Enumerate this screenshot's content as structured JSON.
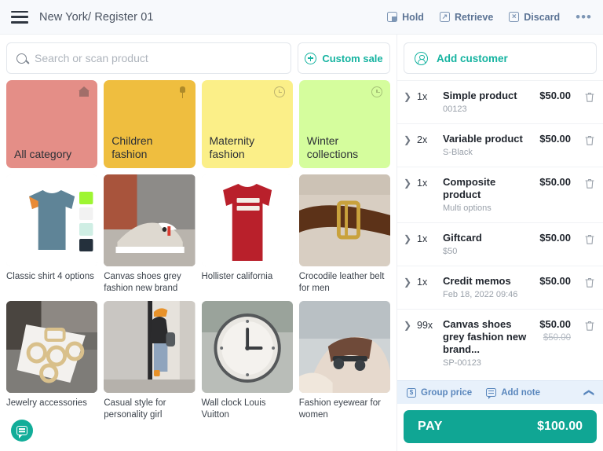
{
  "header": {
    "menu_icon": "hamburger-menu-icon",
    "title": "New York/ Register 01",
    "actions": [
      {
        "label": "Hold",
        "icon": "hold-icon"
      },
      {
        "label": "Retrieve",
        "icon": "retrieve-icon"
      },
      {
        "label": "Discard",
        "icon": "discard-icon"
      }
    ],
    "more_label": "•••"
  },
  "search": {
    "icon": "search-icon",
    "value": "",
    "placeholder": "Search or scan product"
  },
  "custom_sale": {
    "label": "Custom sale",
    "icon": "plus-circle-icon"
  },
  "categories": [
    {
      "label": "All category",
      "icon": "home-icon",
      "color": "#e48e87"
    },
    {
      "label": "Children fashion",
      "icon": "pin-icon",
      "color": "#efbe3f"
    },
    {
      "label": "Maternity fashion",
      "icon": "history-icon",
      "color": "#fbef88"
    },
    {
      "label": "Winter collections",
      "icon": "history-icon",
      "color": "#d5fd9d"
    }
  ],
  "products": [
    {
      "name": "Classic shirt 4 options"
    },
    {
      "name": "Canvas shoes grey fashion new brand"
    },
    {
      "name": "Hollister california"
    },
    {
      "name": "Crocodile leather belt for men"
    },
    {
      "name": "Jewelry accessories"
    },
    {
      "name": "Casual style for personality girl"
    },
    {
      "name": "Wall clock Louis Vuitton"
    },
    {
      "name": "Fashion eyewear for women"
    }
  ],
  "support": {
    "icon": "chat-bubble-icon"
  },
  "add_customer": {
    "label": "Add customer",
    "icon": "user-circle-icon"
  },
  "cart": {
    "items": [
      {
        "qty": "1x",
        "name": "Simple product",
        "sub": "00123",
        "price": "$50.00",
        "old_price": ""
      },
      {
        "qty": "2x",
        "name": "Variable product",
        "sub": "S-Black",
        "price": "$50.00",
        "old_price": ""
      },
      {
        "qty": "1x",
        "name": "Composite product",
        "sub": "Multi options",
        "price": "$50.00",
        "old_price": ""
      },
      {
        "qty": "1x",
        "name": "Giftcard",
        "sub": "$50",
        "price": "$50.00",
        "old_price": ""
      },
      {
        "qty": "1x",
        "name": "Credit memos",
        "sub": "Feb 18, 2022 09:46",
        "price": "$50.00",
        "old_price": ""
      },
      {
        "qty": "99x",
        "name": "Canvas shoes grey fashion new brand...",
        "sub": "SP-00123",
        "price": "$50.00",
        "old_price": "$50.00"
      }
    ],
    "footer": {
      "group_price_label": "Group price",
      "add_note_label": "Add note",
      "collapse_icon": "chevron-up-icon"
    }
  },
  "pay": {
    "label": "PAY",
    "amount": "$100.00",
    "color": "#10a694"
  }
}
